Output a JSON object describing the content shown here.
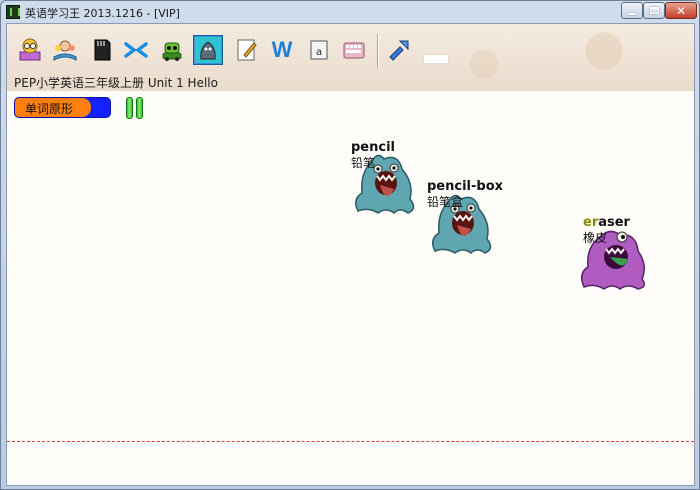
{
  "window": {
    "title": "英语学习王 2013.1216 - [VIP]"
  },
  "toolbar": {
    "buttons": [
      {
        "name": "reading-icon",
        "label": ""
      },
      {
        "name": "study-icon",
        "label": ""
      },
      {
        "name": "sd-card-icon",
        "label": ""
      },
      {
        "name": "shuffle-icon",
        "label": ""
      },
      {
        "name": "robot-icon",
        "label": ""
      },
      {
        "name": "monster-game-icon",
        "label": ""
      },
      {
        "name": "edit-icon",
        "label": ""
      },
      {
        "name": "word-icon",
        "label": "W"
      },
      {
        "name": "dictation-icon",
        "label": ""
      },
      {
        "name": "keyboard-icon",
        "label": ""
      },
      {
        "name": "tools-icon",
        "label": ""
      }
    ]
  },
  "breadcrumb": "PEP小学英语三年级上册 Unit 1 Hello",
  "mode": {
    "label": "单词原形"
  },
  "colors": {
    "orange": "#ff7f10",
    "blue": "#1521ff",
    "baseline": "#d84040",
    "monster_blue": "#5fa6b0",
    "monster_purple": "#b05cc0"
  },
  "monsters": [
    {
      "word": "pencil",
      "typed": "",
      "rest": "pencil",
      "meaning": "铅笔",
      "color": "blue"
    },
    {
      "word": "pencil-box",
      "typed": "",
      "rest": "pencil-box",
      "meaning": "铅笔盒",
      "color": "blue"
    },
    {
      "word": "eraser",
      "typed": "er",
      "rest": "aser",
      "meaning": "橡皮",
      "color": "purple"
    }
  ]
}
